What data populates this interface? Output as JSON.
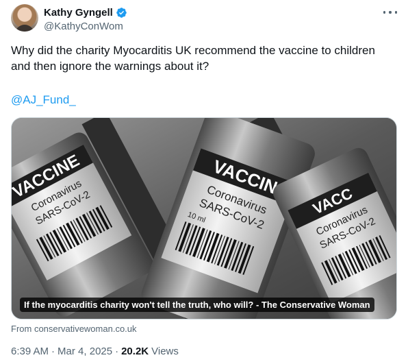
{
  "author": {
    "display_name": "Kathy Gyngell",
    "handle": "@KathyConWom",
    "verified": true
  },
  "tweet": {
    "text": "Why did the charity Myocarditis UK recommend the vaccine to children and then ignore the warnings about it?",
    "mention": "@AJ_Fund_"
  },
  "card": {
    "image_vials": [
      {
        "label_top": "VACCINE",
        "line1": "Coronavirus",
        "line2": "SARS-CoV-2"
      },
      {
        "label_top": "VACCIN",
        "line1": "Coronavirus",
        "line2": "SARS-CoV-2",
        "volume": "10 ml"
      },
      {
        "label_top": "VACC",
        "line1": "Coronavirus",
        "line2": "SARS-CoV-2"
      }
    ],
    "caption": "If the myocarditis charity won't tell the truth, who will? - The Conservative Woman",
    "source": "From conservativewoman.co.uk"
  },
  "meta": {
    "time": "6:39 AM",
    "separator": "·",
    "date": "Mar 4, 2025",
    "views_count": "20.2K",
    "views_label": "Views"
  },
  "icons": {
    "verified": "verified-badge-icon",
    "more": "more-options-icon"
  },
  "colors": {
    "link": "#1d9bf0",
    "verified": "#1d9bf0",
    "secondary_text": "#536471"
  }
}
